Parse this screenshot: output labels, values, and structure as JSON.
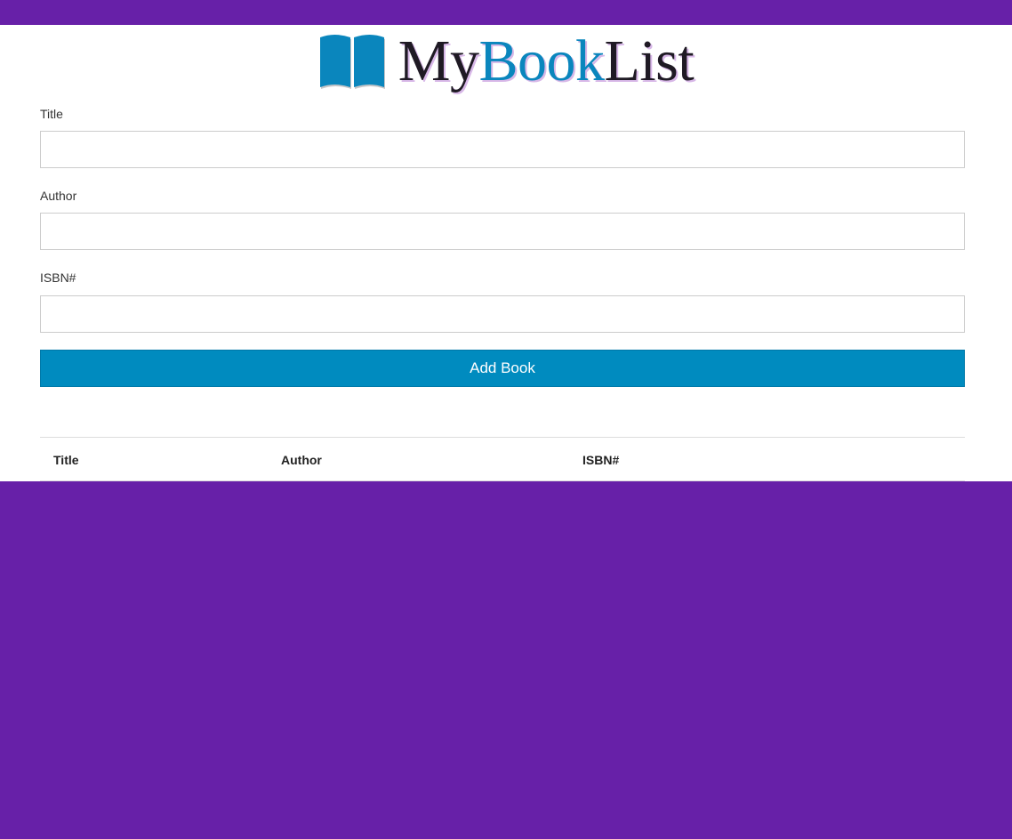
{
  "app": {
    "logo": {
      "part1": "My",
      "part2": "Book",
      "part3": "List",
      "icon": "open-book-icon"
    }
  },
  "form": {
    "title_label": "Title",
    "title_value": "",
    "author_label": "Author",
    "author_value": "",
    "isbn_label": "ISBN#",
    "isbn_value": "",
    "submit_label": "Add Book"
  },
  "table": {
    "columns": [
      "Title",
      "Author",
      "ISBN#"
    ],
    "rows": []
  },
  "colors": {
    "background": "#6720a8",
    "accent": "#008bbf",
    "logo_dark": "#1f1a24",
    "logo_blue": "#0a86bd"
  }
}
